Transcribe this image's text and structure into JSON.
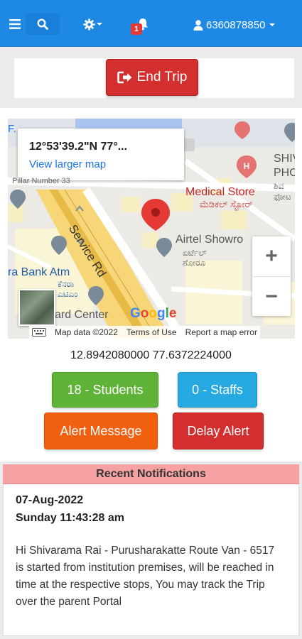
{
  "navbar": {
    "user_phone": "6360878850",
    "notification_count": "1",
    "icons": [
      "menu-icon",
      "search-icon",
      "gear-icon",
      "bell-icon",
      "user-icon"
    ],
    "bg_color": "#1e88e5"
  },
  "trip": {
    "end_trip_label": "End Trip"
  },
  "map": {
    "info_coords": "12°53'39.2\"N 77°...",
    "view_larger": "View larger map",
    "labels": {
      "fa": "F.",
      "pillar": "Pillar Number 33",
      "medical": "Medical Store",
      "medical_kn": "ಮೆಡಿಕಲ್ ಸ್ಟೋರ್",
      "shiv": "SHIV",
      "pho": "PHO",
      "shiv_kn1": "ಶಿವ",
      "shiv_kn2": "ಫೋಟ",
      "service_rd": "Service Rd",
      "airtel": "Airtel Showro",
      "airtel_kn1": "ಏರ್ಟೆಲ್",
      "airtel_kn2": "ಶೋರೂ",
      "bank": "ra Bank Atm",
      "bank_kn1": "ಕೆನರಾ",
      "bank_kn2": "ಎಟಿಎಂ",
      "card_center": "ard Center",
      "google": "Google"
    },
    "zoom_in": "+",
    "zoom_out": "−",
    "footer": {
      "map_data": "Map data ©2022",
      "terms": "Terms of Use",
      "report": "Report a map error"
    }
  },
  "location": {
    "coords_text": "12.8942080000 77.6372224000"
  },
  "actions": {
    "students_label": "18 - Students",
    "staffs_label": "0 - Staffs",
    "alert_label": "Alert Message",
    "delay_label": "Delay Alert"
  },
  "notifications": {
    "header": "Recent Notifications",
    "items": [
      {
        "date": "07-Aug-2022",
        "time": "Sunday 11:43:28 am",
        "message": "Hi Shivarama Rai - Purusharakatte Route Van - 6517 is started from institution premises, will be reached in time at the respective stops, You may track the Trip over the parent Portal"
      }
    ]
  }
}
